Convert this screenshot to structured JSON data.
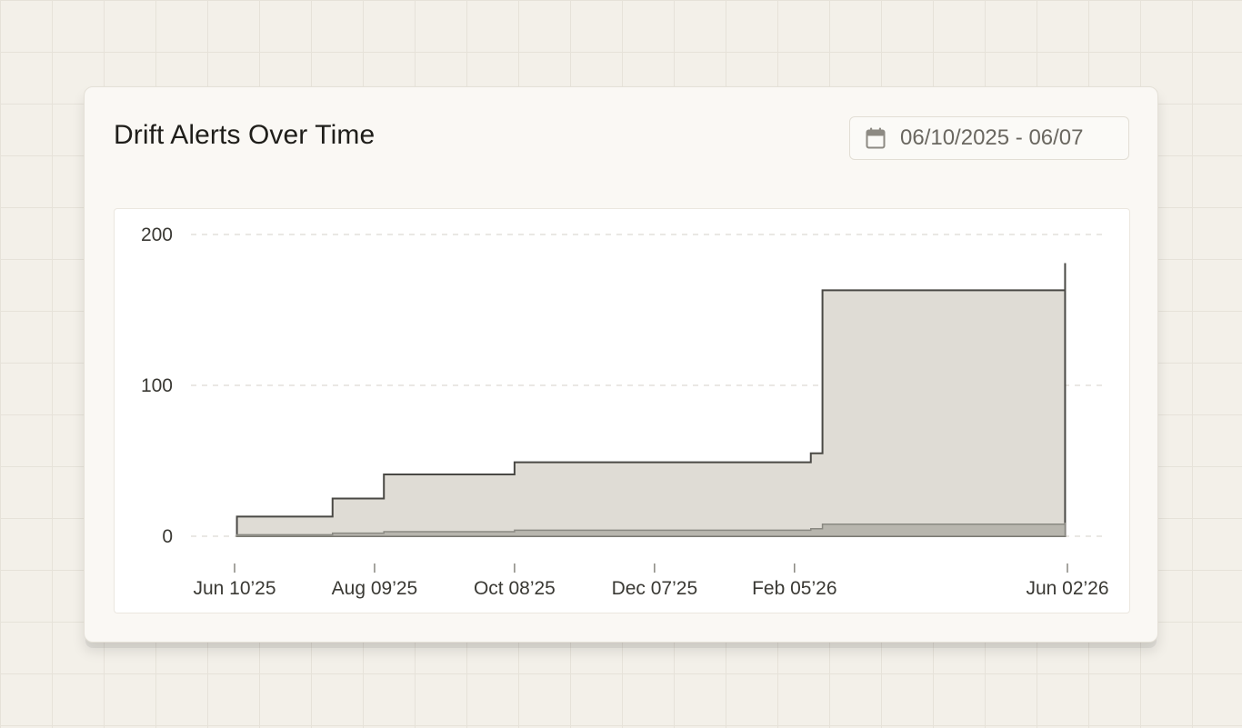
{
  "card": {
    "title": "Drift Alerts Over Time",
    "date_range": "06/10/2025 - 06/07",
    "date_icon": "calendar-icon"
  },
  "chart_data": {
    "type": "area",
    "step": true,
    "stacked": false,
    "x_scale": "time",
    "xlim": [
      "2025-06-10",
      "2026-06-02"
    ],
    "ylim": [
      0,
      200
    ],
    "y_ticks": [
      {
        "value": 0,
        "label": "0"
      },
      {
        "value": 100,
        "label": "100"
      },
      {
        "value": 200,
        "label": "200"
      }
    ],
    "x_ticks": [
      {
        "date": "2025-06-10",
        "label": "Jun 10’25"
      },
      {
        "date": "2025-08-09",
        "label": "Aug 09’25"
      },
      {
        "date": "2025-10-08",
        "label": "Oct 08’25"
      },
      {
        "date": "2025-12-07",
        "label": "Dec 07’25"
      },
      {
        "date": "2026-02-05",
        "label": "Feb 05’26"
      },
      {
        "date": "2026-06-02",
        "label": "Jun 02’26"
      }
    ],
    "grid": "horizontal-dashed",
    "legend": "none",
    "colors": {
      "series_fill": "#dfdcd5",
      "series_stroke": "#4a4945",
      "series2_fill": "#b8b6ae",
      "series2_stroke": "#8a8982",
      "grid": "#e3e1dc",
      "axis_tick": "#888780"
    },
    "series": [
      {
        "x": [
          "2025-06-11",
          "2025-07-11",
          "2025-07-22",
          "2025-08-13",
          "2025-10-08",
          "2026-02-12",
          "2026-02-17",
          "2026-06-01"
        ],
        "y": [
          13,
          13,
          25,
          41,
          49,
          55,
          163,
          181
        ]
      },
      {
        "x": [
          "2025-06-11",
          "2025-07-11",
          "2025-07-22",
          "2025-08-13",
          "2025-10-08",
          "2026-02-12",
          "2026-02-17",
          "2026-06-01"
        ],
        "y": [
          1,
          1,
          2,
          3,
          4,
          5,
          8,
          9
        ]
      }
    ]
  }
}
